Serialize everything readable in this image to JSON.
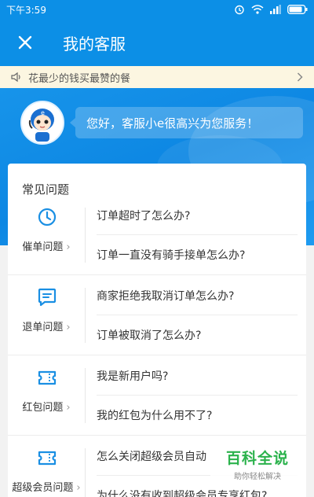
{
  "status_bar": {
    "time": "下午3:59"
  },
  "nav": {
    "title": "我的客服",
    "close_icon": "close-icon"
  },
  "notice": {
    "text": "花最少的钱买最赞的餐"
  },
  "hero": {
    "greeting": "您好，客服小e很高兴为您服务！"
  },
  "faq": {
    "title": "常见问题",
    "sections": [
      {
        "label": "催单问题",
        "chev": "›",
        "icon": "clock-icon",
        "questions": [
          "订单超时了怎么办?",
          "订单一直没有骑手接单怎么办?"
        ]
      },
      {
        "label": "退单问题",
        "chev": "›",
        "icon": "chat-icon",
        "questions": [
          "商家拒绝我取消订单怎么办?",
          "订单被取消了怎么办?"
        ]
      },
      {
        "label": "红包问题",
        "chev": "›",
        "icon": "ticket-icon",
        "questions": [
          "我是新用户吗?",
          "我的红包为什么用不了?"
        ]
      },
      {
        "label": "超级会员问题",
        "chev": "›",
        "icon": "vip-ticket-icon",
        "questions": [
          "怎么关闭超级会员自动",
          "为什么没有收到超级会员专享红包?"
        ]
      }
    ]
  },
  "watermark": {
    "main": "百科全说",
    "sub": "助你轻松解决"
  },
  "colors": {
    "brand_blue": "#0c8fe6",
    "notice_bg": "#fcf6e1"
  }
}
